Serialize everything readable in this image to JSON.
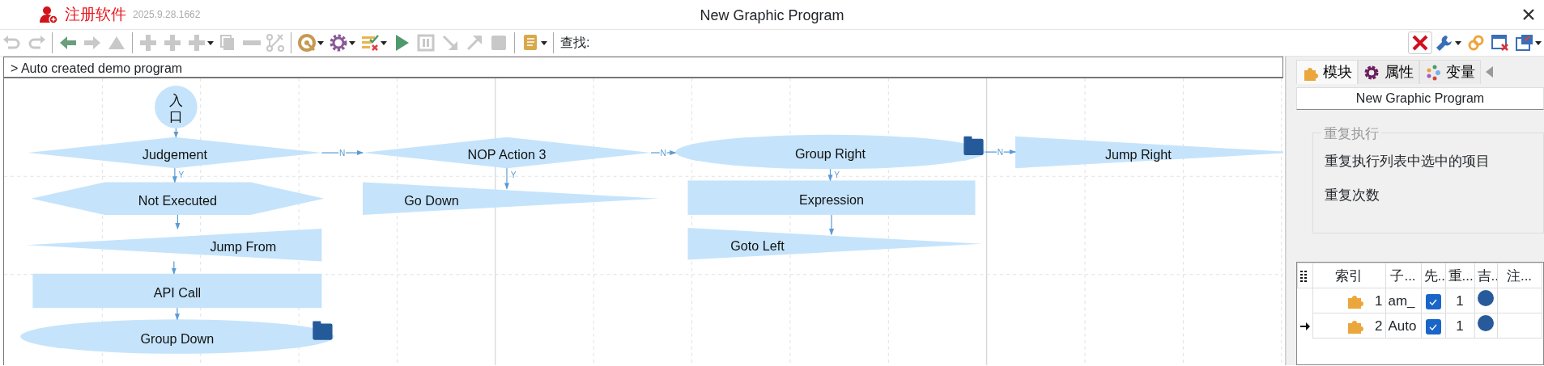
{
  "title_bar": {
    "registration": "注册软件",
    "version": "2025.9.28.1662",
    "title": "New Graphic Program"
  },
  "toolbar": [
    {
      "kind": "undo",
      "disabled": true
    },
    {
      "kind": "redo",
      "disabled": true
    },
    {
      "kind": "separator"
    },
    {
      "kind": "back",
      "disabled": false
    },
    {
      "kind": "forward",
      "disabled": true
    },
    {
      "kind": "up",
      "disabled": true
    },
    {
      "kind": "separator"
    },
    {
      "kind": "add",
      "disabled": true
    },
    {
      "kind": "add",
      "disabled": true
    },
    {
      "kind": "add",
      "disabled": true,
      "dropdown": true
    },
    {
      "kind": "copy",
      "disabled": true
    },
    {
      "kind": "remove",
      "disabled": true
    },
    {
      "kind": "unlink",
      "disabled": true
    },
    {
      "kind": "separator"
    },
    {
      "kind": "target",
      "disabled": false,
      "dropdown": true
    },
    {
      "kind": "gear",
      "disabled": false,
      "dropdown": true
    },
    {
      "kind": "checklist",
      "disabled": false,
      "dropdown": true
    },
    {
      "kind": "play",
      "disabled": false
    },
    {
      "kind": "pause",
      "disabled": true
    },
    {
      "kind": "stepin",
      "disabled": true
    },
    {
      "kind": "stepout",
      "disabled": true
    },
    {
      "kind": "stop",
      "disabled": true
    },
    {
      "kind": "separator"
    },
    {
      "kind": "script",
      "disabled": false,
      "dropdown": true
    },
    {
      "kind": "separator"
    }
  ],
  "search": {
    "label": "查找:"
  },
  "toolbar_right": [
    {
      "kind": "clear"
    },
    {
      "kind": "wrench",
      "dropdown": true
    },
    {
      "kind": "link"
    },
    {
      "kind": "closewin"
    },
    {
      "kind": "export",
      "dropdown": true
    }
  ],
  "breadcrumb": "> Auto created demo program",
  "diagram": {
    "nodes": [
      {
        "label": "入口",
        "kind": "start"
      },
      {
        "label": "Judgement",
        "kind": "decision"
      },
      {
        "label": "NOP Action 3",
        "kind": "decision"
      },
      {
        "label": "Group Right",
        "kind": "group"
      },
      {
        "label": "Jump Right",
        "kind": "wedge-right"
      },
      {
        "label": "Not Executed",
        "kind": "hexagon"
      },
      {
        "label": "Go Down",
        "kind": "wedge-right"
      },
      {
        "label": "Expression",
        "kind": "action"
      },
      {
        "label": "Jump From",
        "kind": "wedge-left"
      },
      {
        "label": "Goto Left",
        "kind": "wedge-right"
      },
      {
        "label": "API Call",
        "kind": "action"
      },
      {
        "label": "Group Down",
        "kind": "group"
      }
    ],
    "link_labels": [
      {
        "label": "N"
      },
      {
        "label": "Y"
      },
      {
        "label": "N"
      },
      {
        "label": "Y"
      },
      {
        "label": "N"
      },
      {
        "label": "Y"
      }
    ]
  },
  "panel": {
    "tabs": [
      {
        "label": "模块",
        "kind": "module",
        "selected": true
      },
      {
        "label": "属性",
        "kind": "property",
        "selected": false
      },
      {
        "label": "变量",
        "kind": "variable",
        "selected": false
      }
    ],
    "name": "New Graphic Program",
    "group": {
      "legend": "重复执行",
      "items": [
        "重复执行列表中选中的项目",
        "重复次数"
      ]
    },
    "table": {
      "columns": [
        "索引",
        "子...",
        "先..",
        "重...",
        "吉..",
        "注..."
      ],
      "rows": [
        {
          "index": "1",
          "name": "am_",
          "checked": true,
          "repeat": "1",
          "color": "#275a9a",
          "current": false
        },
        {
          "index": "2",
          "name": "Auto",
          "checked": true,
          "repeat": "1",
          "color": "#275a9a",
          "current": true
        }
      ]
    }
  }
}
